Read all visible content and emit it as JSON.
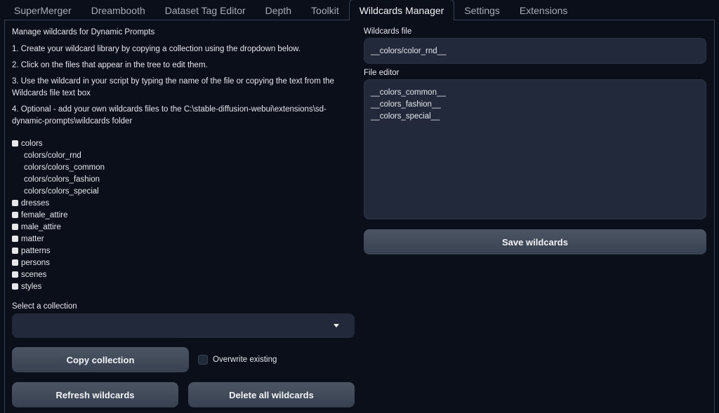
{
  "tabs": [
    {
      "label": "SuperMerger",
      "active": false
    },
    {
      "label": "Dreambooth",
      "active": false
    },
    {
      "label": "Dataset Tag Editor",
      "active": false
    },
    {
      "label": "Depth",
      "active": false
    },
    {
      "label": "Toolkit",
      "active": false
    },
    {
      "label": "Wildcards Manager",
      "active": true
    },
    {
      "label": "Settings",
      "active": false
    },
    {
      "label": "Extensions",
      "active": false
    }
  ],
  "intro": {
    "title": "Manage wildcards for Dynamic Prompts",
    "steps": [
      "1. Create your wildcard library by copying a collection using the dropdown below.",
      "2. Click on the files that appear in the tree to edit them.",
      "3. Use the wildcard in your script by typing the name of the file or copying the text from the Wildcards file text box",
      "4. Optional - add your own wildcards files to the C:\\stable-diffusion-webui\\extensions\\sd-dynamic-prompts\\wildcards folder"
    ]
  },
  "tree": [
    {
      "label": "colors",
      "type": "folder"
    },
    {
      "label": "colors/color_rnd",
      "type": "file"
    },
    {
      "label": "colors/colors_common",
      "type": "file"
    },
    {
      "label": "colors/colors_fashion",
      "type": "file"
    },
    {
      "label": "colors/colors_special",
      "type": "file"
    },
    {
      "label": "dresses",
      "type": "folder"
    },
    {
      "label": "female_attire",
      "type": "folder"
    },
    {
      "label": "male_attire",
      "type": "folder"
    },
    {
      "label": "matter",
      "type": "folder"
    },
    {
      "label": "patterns",
      "type": "folder"
    },
    {
      "label": "persons",
      "type": "folder"
    },
    {
      "label": "scenes",
      "type": "folder"
    },
    {
      "label": "styles",
      "type": "folder"
    }
  ],
  "collection": {
    "label": "Select a collection",
    "value": ""
  },
  "buttons": {
    "copy": "Copy collection",
    "refresh": "Refresh wildcards",
    "delete": "Delete all wildcards",
    "save": "Save wildcards"
  },
  "overwrite": {
    "label": "Overwrite existing",
    "checked": false
  },
  "wildcards_file": {
    "label": "Wildcards file",
    "value": "__colors/color_rnd__"
  },
  "file_editor": {
    "label": "File editor",
    "value": "__colors_common__\n__colors_fashion__\n__colors_special__"
  }
}
